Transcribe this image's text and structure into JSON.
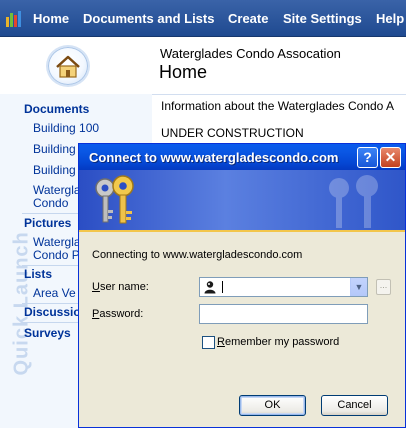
{
  "top_nav": {
    "items": [
      "Home",
      "Documents and Lists",
      "Create",
      "Site Settings",
      "Help"
    ]
  },
  "site": {
    "name": "Waterglades Condo Assocation",
    "page_title": "Home"
  },
  "quick_launch": {
    "label": "Quick Launch",
    "sections": [
      {
        "heading": "Documents",
        "items": [
          "Building 100",
          "Building",
          "Building",
          "Watergla",
          "Condo"
        ]
      },
      {
        "heading": "Pictures",
        "items": [
          "Watergla",
          "Condo P"
        ]
      },
      {
        "heading": "Lists",
        "items": [
          "Area Ve"
        ]
      },
      {
        "heading": "Discussion",
        "items": []
      },
      {
        "heading": "Surveys",
        "items": []
      }
    ]
  },
  "content": {
    "intro": "Information about the Waterglades Condo A",
    "status": "UNDER CONSTRUCTION"
  },
  "dialog": {
    "title": "Connect to www.watergladescondo.com",
    "connecting_text": "Connecting to www.watergladescondo.com",
    "username_label_u": "U",
    "username_label_rest": "ser name:",
    "username_value": "",
    "password_label_u": "P",
    "password_label_rest": "assword:",
    "password_value": "",
    "remember_label_u": "R",
    "remember_label_rest": "emember my password",
    "remember_checked": false,
    "browse_label": "...",
    "ok_label": "OK",
    "cancel_label": "Cancel",
    "help_glyph": "?",
    "close_glyph": "✕"
  },
  "colors": {
    "topbar": "#2a579f",
    "link": "#003399",
    "xp_title": "#0548d5",
    "dialog_face": "#ece9d8"
  }
}
